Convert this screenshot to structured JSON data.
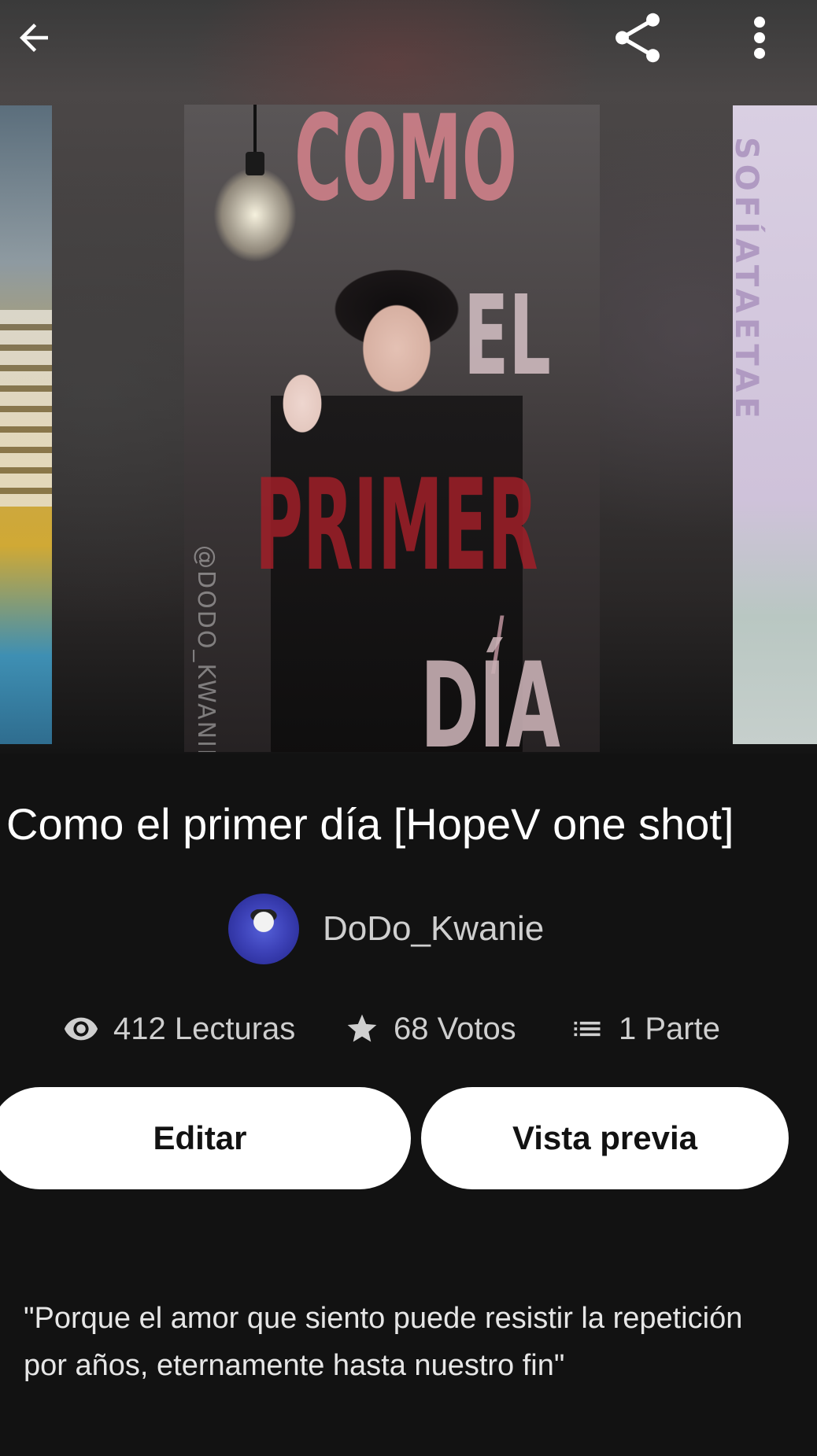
{
  "topbar": {
    "back_icon": "arrow-left-icon",
    "share_icon": "share-icon",
    "more_icon": "more-vertical-icon"
  },
  "cover": {
    "words": [
      "COMO",
      "EL",
      "PRIMER",
      "/",
      "DÍA"
    ],
    "watermark": "@DODO_KWANIE",
    "right_cover_text": "SOFÍATAETAE"
  },
  "story": {
    "title": "Como el primer día [HopeV one shot]",
    "author": "DoDo_Kwanie",
    "reads": "412 Lecturas",
    "votes": "68 Votos",
    "parts": "1 Parte",
    "description": "\"Porque el amor que siento puede resistir la repetición por años, eternamente hasta nuestro fin\""
  },
  "actions": {
    "edit_label": "Editar",
    "preview_label": "Vista previa"
  },
  "colors": {
    "background": "#121212",
    "button_bg": "#ffffff",
    "button_text": "#121212",
    "secondary_text": "#cfcfcf"
  }
}
